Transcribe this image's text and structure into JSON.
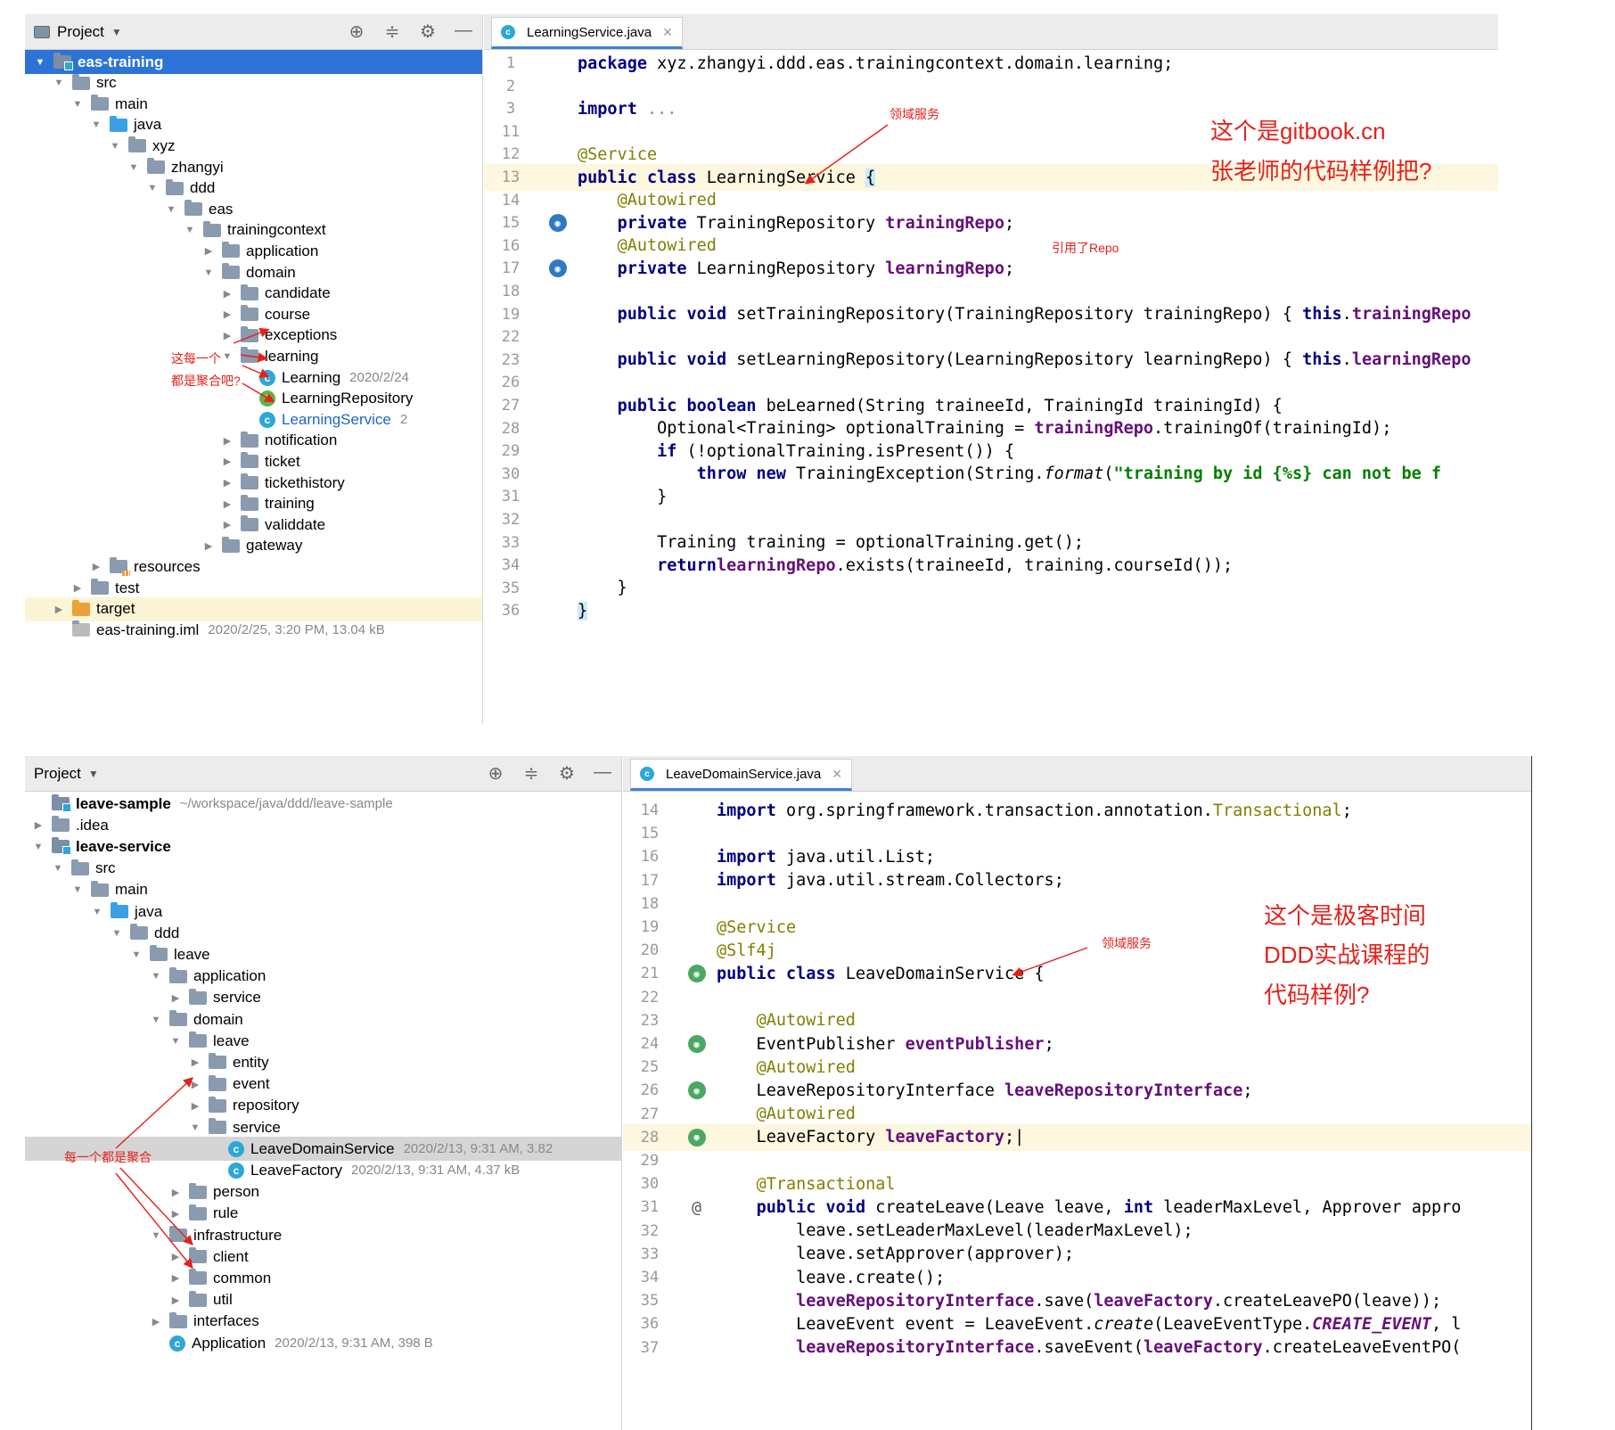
{
  "top": {
    "project_header": {
      "title": "Project"
    },
    "tree": [
      {
        "label": "eas-training",
        "depth": 0,
        "arrow": "down",
        "icon": "mod",
        "state": "sel"
      },
      {
        "label": "src",
        "depth": 1,
        "arrow": "down",
        "icon": "folder"
      },
      {
        "label": "main",
        "depth": 2,
        "arrow": "down",
        "icon": "folder"
      },
      {
        "label": "java",
        "depth": 3,
        "arrow": "down",
        "icon": "blue"
      },
      {
        "label": "xyz",
        "depth": 4,
        "arrow": "down",
        "icon": "folder"
      },
      {
        "label": "zhangyi",
        "depth": 5,
        "arrow": "down",
        "icon": "folder"
      },
      {
        "label": "ddd",
        "depth": 6,
        "arrow": "down",
        "icon": "folder"
      },
      {
        "label": "eas",
        "depth": 7,
        "arrow": "down",
        "icon": "folder"
      },
      {
        "label": "trainingcontext",
        "depth": 8,
        "arrow": "down",
        "icon": "folder"
      },
      {
        "label": "application",
        "depth": 9,
        "arrow": "right",
        "icon": "folder"
      },
      {
        "label": "domain",
        "depth": 9,
        "arrow": "down",
        "icon": "folder"
      },
      {
        "label": "candidate",
        "depth": 10,
        "arrow": "right",
        "icon": "folder"
      },
      {
        "label": "course",
        "depth": 10,
        "arrow": "right",
        "icon": "folder"
      },
      {
        "label": "exceptions",
        "depth": 10,
        "arrow": "right",
        "icon": "folder"
      },
      {
        "label": "learning",
        "depth": 10,
        "arrow": "down",
        "icon": "folder"
      },
      {
        "label": "Learning",
        "depth": 11,
        "arrow": "none",
        "icon": "class",
        "meta": "2020/2/24"
      },
      {
        "label": "LearningRepository",
        "depth": 11,
        "arrow": "none",
        "icon": "iface"
      },
      {
        "label": "LearningService",
        "depth": 11,
        "arrow": "none",
        "icon": "class",
        "meta": "2",
        "state": "blue"
      },
      {
        "label": "notification",
        "depth": 10,
        "arrow": "right",
        "icon": "folder"
      },
      {
        "label": "ticket",
        "depth": 10,
        "arrow": "right",
        "icon": "folder"
      },
      {
        "label": "tickethistory",
        "depth": 10,
        "arrow": "right",
        "icon": "folder"
      },
      {
        "label": "training",
        "depth": 10,
        "arrow": "right",
        "icon": "folder"
      },
      {
        "label": "validdate",
        "depth": 10,
        "arrow": "right",
        "icon": "folder"
      },
      {
        "label": "gateway",
        "depth": 9,
        "arrow": "right",
        "icon": "folder"
      },
      {
        "label": "resources",
        "depth": 3,
        "arrow": "right",
        "icon": "res"
      },
      {
        "label": "test",
        "depth": 2,
        "arrow": "right",
        "icon": "folder"
      },
      {
        "label": "target",
        "depth": 1,
        "arrow": "right",
        "icon": "orange",
        "state": "hl-y"
      },
      {
        "label": "eas-training.iml",
        "depth": 1,
        "arrow": "none",
        "icon": "file",
        "meta": "2020/2/25, 3:20 PM, 13.04 kB"
      }
    ],
    "tab": {
      "label": "LearningService.java"
    },
    "lines": [
      {
        "n": "1",
        "tokens": [
          [
            "kw",
            "package"
          ],
          [
            "",
            " xyz.zhangyi.ddd.eas.trainingcontext.domain.learning;"
          ]
        ]
      },
      {
        "n": "2",
        "tokens": []
      },
      {
        "n": "3",
        "tokens": [
          [
            "kw",
            "import"
          ],
          [
            "",
            " "
          ],
          [
            "fold",
            "..."
          ]
        ]
      },
      {
        "n": "11",
        "tokens": []
      },
      {
        "n": "12",
        "tokens": [
          [
            "ann",
            "@Service"
          ]
        ]
      },
      {
        "n": "13",
        "cur": true,
        "tokens": [
          [
            "kw",
            "public class"
          ],
          [
            "",
            " LearningService "
          ],
          [
            "brace",
            "{"
          ]
        ]
      },
      {
        "n": "14",
        "tokens": [
          [
            "",
            "    "
          ],
          [
            "ann",
            "@Autowired"
          ]
        ]
      },
      {
        "n": "15",
        "gutter": "bean-blue",
        "tokens": [
          [
            "",
            "    "
          ],
          [
            "kw",
            "private"
          ],
          [
            "",
            " TrainingRepository "
          ],
          [
            "fld",
            "trainingRepo"
          ],
          [
            "",
            ";"
          ]
        ]
      },
      {
        "n": "16",
        "tokens": [
          [
            "",
            "    "
          ],
          [
            "ann",
            "@Autowired"
          ]
        ]
      },
      {
        "n": "17",
        "gutter": "bean-blue",
        "tokens": [
          [
            "",
            "    "
          ],
          [
            "kw",
            "private"
          ],
          [
            "",
            " LearningRepository "
          ],
          [
            "fld",
            "learningRepo"
          ],
          [
            "",
            ";"
          ]
        ]
      },
      {
        "n": "18",
        "tokens": []
      },
      {
        "n": "19",
        "tokens": [
          [
            "",
            "    "
          ],
          [
            "kw",
            "public void"
          ],
          [
            "",
            " setTrainingRepository(TrainingRepository trainingRepo) { "
          ],
          [
            "kw",
            "this"
          ],
          [
            "",
            "."
          ],
          [
            "fld",
            "trainingRepo"
          ]
        ]
      },
      {
        "n": "22",
        "tokens": []
      },
      {
        "n": "23",
        "tokens": [
          [
            "",
            "    "
          ],
          [
            "kw",
            "public void"
          ],
          [
            "",
            " setLearningRepository(LearningRepository learningRepo) { "
          ],
          [
            "kw",
            "this"
          ],
          [
            "",
            "."
          ],
          [
            "fld",
            "learningRepo"
          ]
        ]
      },
      {
        "n": "26",
        "tokens": []
      },
      {
        "n": "27",
        "tokens": [
          [
            "",
            "    "
          ],
          [
            "kw",
            "public boolean"
          ],
          [
            "",
            " beLearned(String traineeId, TrainingId trainingId) {"
          ]
        ]
      },
      {
        "n": "28",
        "tokens": [
          [
            "",
            "        Optional<Training> optionalTraining = "
          ],
          [
            "fld",
            "trainingRepo"
          ],
          [
            "",
            ".trainingOf(trainingId);"
          ]
        ]
      },
      {
        "n": "29",
        "tokens": [
          [
            "",
            "        "
          ],
          [
            "kw",
            "if"
          ],
          [
            "",
            " (!optionalTraining.isPresent()) {"
          ]
        ]
      },
      {
        "n": "30",
        "tokens": [
          [
            "",
            "            "
          ],
          [
            "kw",
            "throw new"
          ],
          [
            "",
            " TrainingException(String."
          ],
          [
            "it",
            "format"
          ],
          [
            "",
            "("
          ],
          [
            "str",
            "\"training by id {%s} can not be f"
          ]
        ]
      },
      {
        "n": "31",
        "tokens": [
          [
            "",
            "        }"
          ]
        ]
      },
      {
        "n": "32",
        "tokens": []
      },
      {
        "n": "33",
        "tokens": [
          [
            "",
            "        Training training = optionalTraining.get();"
          ]
        ]
      },
      {
        "n": "34",
        "tokens": [
          [
            "",
            "        "
          ],
          [
            "kw",
            "return"
          ],
          [
            " ",
            ""
          ],
          [
            "fld",
            "learningRepo"
          ],
          [
            "",
            ".exists(traineeId, training.courseId());"
          ]
        ]
      },
      {
        "n": "35",
        "tokens": [
          [
            "",
            "    }"
          ]
        ]
      },
      {
        "n": "36",
        "tokens": [
          [
            "brace",
            "}"
          ]
        ]
      }
    ],
    "notes": {
      "domain_service": "领域服务",
      "ref_repo": "引用了Repo",
      "big1": "这个是gitbook.cn",
      "big2": "张老师的代码样例把?",
      "agg1": "这每一个",
      "agg2": "都是聚合吧?"
    }
  },
  "bottom": {
    "project_header": {
      "title": "Project"
    },
    "tree": [
      {
        "label": "leave-sample",
        "depth": 0,
        "arrow": "none",
        "icon": "mod",
        "meta": "~/workspace/java/ddd/leave-sample",
        "bold": true
      },
      {
        "label": ".idea",
        "depth": 0,
        "arrow": "right",
        "icon": "folder"
      },
      {
        "label": "leave-service",
        "depth": 0,
        "arrow": "down",
        "icon": "mod",
        "bold": true
      },
      {
        "label": "src",
        "depth": 1,
        "arrow": "down",
        "icon": "folder"
      },
      {
        "label": "main",
        "depth": 2,
        "arrow": "down",
        "icon": "folder"
      },
      {
        "label": "java",
        "depth": 3,
        "arrow": "down",
        "icon": "blue"
      },
      {
        "label": "ddd",
        "depth": 4,
        "arrow": "down",
        "icon": "folder"
      },
      {
        "label": "leave",
        "depth": 5,
        "arrow": "down",
        "icon": "folder"
      },
      {
        "label": "application",
        "depth": 6,
        "arrow": "down",
        "icon": "folder"
      },
      {
        "label": "service",
        "depth": 7,
        "arrow": "right",
        "icon": "folder"
      },
      {
        "label": "domain",
        "depth": 6,
        "arrow": "down",
        "icon": "folder"
      },
      {
        "label": "leave",
        "depth": 7,
        "arrow": "down",
        "icon": "folder"
      },
      {
        "label": "entity",
        "depth": 8,
        "arrow": "right",
        "icon": "folder"
      },
      {
        "label": "event",
        "depth": 8,
        "arrow": "right",
        "icon": "folder"
      },
      {
        "label": "repository",
        "depth": 8,
        "arrow": "right",
        "icon": "folder"
      },
      {
        "label": "service",
        "depth": 8,
        "arrow": "down",
        "icon": "folder"
      },
      {
        "label": "LeaveDomainService",
        "depth": 9,
        "arrow": "none",
        "icon": "class",
        "meta": "2020/2/13, 9:31 AM, 3.82",
        "state": "sel2"
      },
      {
        "label": "LeaveFactory",
        "depth": 9,
        "arrow": "none",
        "icon": "class",
        "meta": "2020/2/13, 9:31 AM, 4.37 kB"
      },
      {
        "label": "person",
        "depth": 7,
        "arrow": "right",
        "icon": "folder"
      },
      {
        "label": "rule",
        "depth": 7,
        "arrow": "right",
        "icon": "folder"
      },
      {
        "label": "infrastructure",
        "depth": 6,
        "arrow": "down",
        "icon": "folder"
      },
      {
        "label": "client",
        "depth": 7,
        "arrow": "right",
        "icon": "folder"
      },
      {
        "label": "common",
        "depth": 7,
        "arrow": "right",
        "icon": "folder"
      },
      {
        "label": "util",
        "depth": 7,
        "arrow": "right",
        "icon": "folder"
      },
      {
        "label": "interfaces",
        "depth": 6,
        "arrow": "right",
        "icon": "folder"
      },
      {
        "label": "Application",
        "depth": 6,
        "arrow": "none",
        "icon": "class",
        "meta": "2020/2/13, 9:31 AM, 398 B"
      }
    ],
    "tab": {
      "label": "LeaveDomainService.java"
    },
    "lines": [
      {
        "n": "14",
        "tokens": [
          [
            "kw",
            "import"
          ],
          [
            "",
            " org.springframework.transaction.annotation."
          ],
          [
            "ann",
            "Transactional"
          ],
          [
            "",
            ";"
          ]
        ]
      },
      {
        "n": "15",
        "tokens": []
      },
      {
        "n": "16",
        "tokens": [
          [
            "kw",
            "import"
          ],
          [
            "",
            " java.util.List;"
          ]
        ]
      },
      {
        "n": "17",
        "tokens": [
          [
            "kw",
            "import"
          ],
          [
            "",
            " java.util.stream.Collectors;"
          ]
        ]
      },
      {
        "n": "18",
        "tokens": []
      },
      {
        "n": "19",
        "tokens": [
          [
            "ann",
            "@Service"
          ]
        ]
      },
      {
        "n": "20",
        "tokens": [
          [
            "ann",
            "@Slf4j"
          ]
        ]
      },
      {
        "n": "21",
        "gutter": "bean",
        "tokens": [
          [
            "kw",
            "public class"
          ],
          [
            "",
            " LeaveDomainService {"
          ]
        ]
      },
      {
        "n": "22",
        "tokens": []
      },
      {
        "n": "23",
        "tokens": [
          [
            "",
            "    "
          ],
          [
            "ann",
            "@Autowired"
          ]
        ]
      },
      {
        "n": "24",
        "gutter": "bean",
        "tokens": [
          [
            "",
            "    EventPublisher "
          ],
          [
            "fld",
            "eventPublisher"
          ],
          [
            "",
            ";"
          ]
        ]
      },
      {
        "n": "25",
        "tokens": [
          [
            "",
            "    "
          ],
          [
            "ann",
            "@Autowired"
          ]
        ]
      },
      {
        "n": "26",
        "gutter": "bean",
        "tokens": [
          [
            "",
            "    LeaveRepositoryInterface "
          ],
          [
            "fld",
            "leaveRepositoryInterface"
          ],
          [
            "",
            ";"
          ]
        ]
      },
      {
        "n": "27",
        "tokens": [
          [
            "",
            "    "
          ],
          [
            "ann",
            "@Autowired"
          ]
        ]
      },
      {
        "n": "28",
        "gutter": "bean",
        "cur": true,
        "tokens": [
          [
            "",
            "    LeaveFactory "
          ],
          [
            "fld",
            "leaveFactory"
          ],
          [
            "",
            ";|"
          ]
        ]
      },
      {
        "n": "29",
        "tokens": []
      },
      {
        "n": "30",
        "tokens": [
          [
            "",
            "    "
          ],
          [
            "ann",
            "@Transactional"
          ]
        ]
      },
      {
        "n": "31",
        "gutter": "at",
        "tokens": [
          [
            "",
            "    "
          ],
          [
            "kw",
            "public void"
          ],
          [
            "",
            " createLeave(Leave leave, "
          ],
          [
            "kw",
            "int"
          ],
          [
            "",
            " leaderMaxLevel, Approver appro"
          ]
        ]
      },
      {
        "n": "32",
        "tokens": [
          [
            "",
            "        leave.setLeaderMaxLevel(leaderMaxLevel);"
          ]
        ]
      },
      {
        "n": "33",
        "tokens": [
          [
            "",
            "        leave.setApprover(approver);"
          ]
        ]
      },
      {
        "n": "34",
        "tokens": [
          [
            "",
            "        leave.create();"
          ]
        ]
      },
      {
        "n": "35",
        "tokens": [
          [
            "",
            "        "
          ],
          [
            "fld",
            "leaveRepositoryInterface"
          ],
          [
            "",
            ".save("
          ],
          [
            "fld",
            "leaveFactory"
          ],
          [
            "",
            ".createLeavePO(leave));"
          ]
        ]
      },
      {
        "n": "36",
        "tokens": [
          [
            "",
            "        LeaveEvent event = LeaveEvent."
          ],
          [
            "it",
            "create"
          ],
          [
            "",
            "(LeaveEventType."
          ],
          [
            "cnst",
            "CREATE_EVENT"
          ],
          [
            "",
            ", l"
          ]
        ]
      },
      {
        "n": "37",
        "tokens": [
          [
            "",
            "        "
          ],
          [
            "fld",
            "leaveRepositoryInterface"
          ],
          [
            "",
            ".saveEvent("
          ],
          [
            "fld",
            "leaveFactory"
          ],
          [
            "",
            ".createLeaveEventPO("
          ]
        ]
      }
    ],
    "notes": {
      "domain_service": "领域服务",
      "big1": "这个是极客时间",
      "big2": "DDD实战课程的",
      "big3": "代码样例?",
      "agg": "每一个都是聚合"
    }
  },
  "colors": {
    "accent": "#2d73d6",
    "annotation": "#e3221c"
  }
}
